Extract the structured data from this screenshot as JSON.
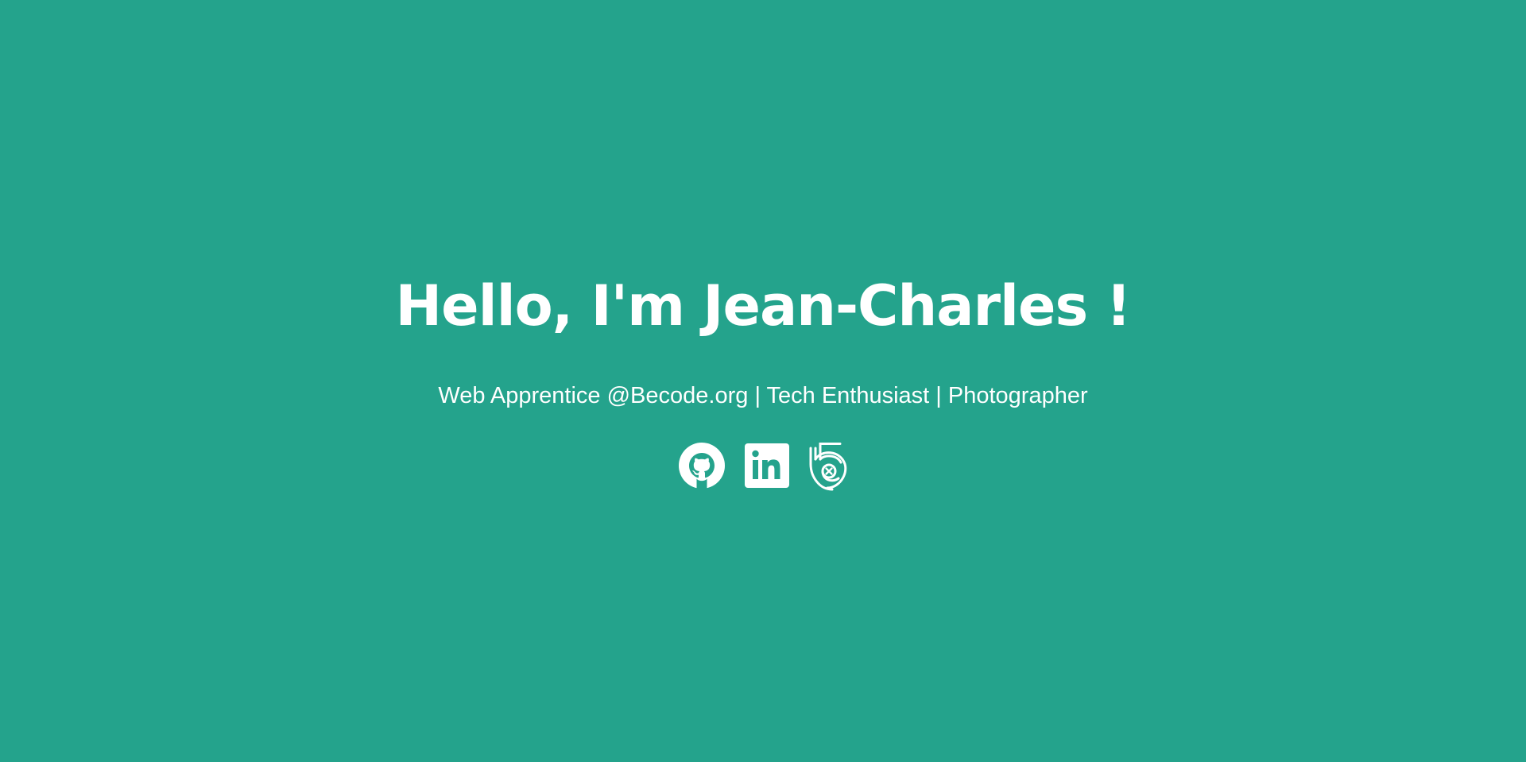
{
  "hero": {
    "title": "Hello, I'm Jean-Charles !",
    "subtitle": "Web Apprentice @Becode.org | Tech Enthusiast | Photographer"
  },
  "socials": [
    {
      "name": "GitHub",
      "icon": "github-icon"
    },
    {
      "name": "LinkedIn",
      "icon": "linkedin-icon"
    },
    {
      "name": "500px",
      "icon": "500px-icon"
    }
  ],
  "colors": {
    "background": "#24a38c",
    "text": "#ffffff"
  }
}
